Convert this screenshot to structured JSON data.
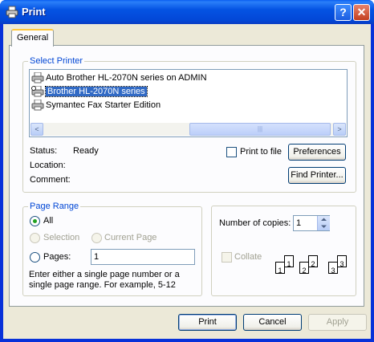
{
  "window": {
    "title": "Print",
    "help_glyph": "?",
    "close_glyph": "✕"
  },
  "tabs": [
    {
      "label": "General"
    }
  ],
  "select_printer": {
    "legend": "Select Printer",
    "printers": [
      {
        "name": "Auto Brother HL-2070N series on ADMIN",
        "selected": false
      },
      {
        "name": "Brother HL-2070N series",
        "selected": true
      },
      {
        "name": "Symantec Fax Starter Edition",
        "selected": false
      }
    ],
    "scroll_left": "<",
    "scroll_right": ">",
    "thumb_grip": "|||",
    "status_label": "Status:",
    "status_value": "Ready",
    "location_label": "Location:",
    "location_value": "",
    "comment_label": "Comment:",
    "comment_value": "",
    "print_to_file_label": "Print to file",
    "print_to_file_checked": false,
    "preferences_label": "Preferences",
    "find_printer_label": "Find Printer..."
  },
  "page_range": {
    "legend": "Page Range",
    "all_label": "All",
    "selection_label": "Selection",
    "current_page_label": "Current Page",
    "pages_label": "Pages:",
    "pages_value": "1",
    "selected": "all",
    "hint": "Enter either a single page number or a single page range.  For example, 5-12"
  },
  "copies": {
    "label": "Number of copies:",
    "value": "1",
    "collate_label": "Collate",
    "collate_checked": false,
    "collate_pages": [
      "1",
      "1",
      "2",
      "2",
      "3",
      "3"
    ]
  },
  "footer": {
    "print_label": "Print",
    "cancel_label": "Cancel",
    "apply_label": "Apply"
  },
  "colors": {
    "title_bar": "#0453e3",
    "legend_text": "#0046d5",
    "selection": "#316ac5",
    "dialog_bg": "#ece9d8"
  }
}
